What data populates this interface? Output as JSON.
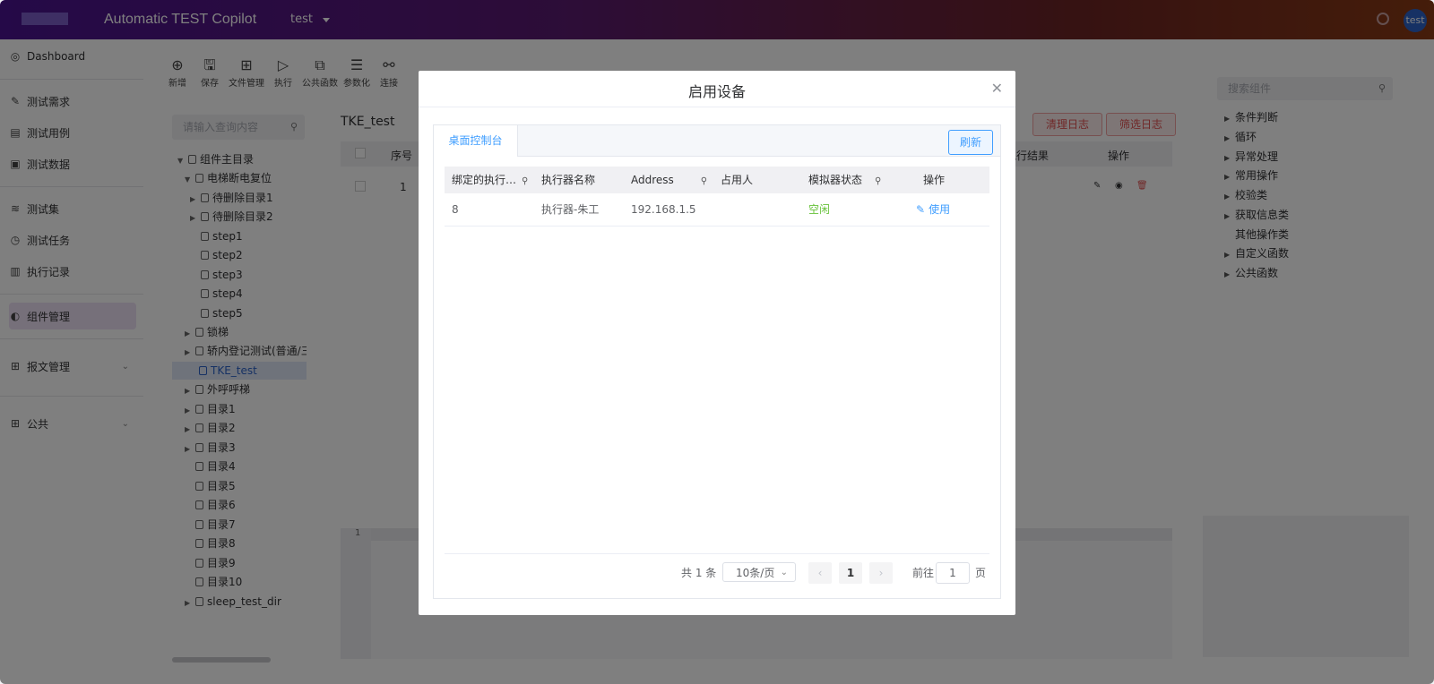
{
  "header": {
    "title": "Automatic TEST Copilot",
    "project": "test",
    "user": "test"
  },
  "sidebar": {
    "items": [
      {
        "label": "Dashboard",
        "icon": "dashboard-icon"
      },
      {
        "label": "测试需求",
        "icon": "requirement-icon"
      },
      {
        "label": "测试用例",
        "icon": "testcase-icon"
      },
      {
        "label": "测试数据",
        "icon": "testdata-icon"
      },
      {
        "label": "测试集",
        "icon": "layers-icon"
      },
      {
        "label": "测试任务",
        "icon": "timer-icon"
      },
      {
        "label": "执行记录",
        "icon": "record-icon"
      },
      {
        "label": "组件管理",
        "icon": "component-icon"
      },
      {
        "label": "报文管理",
        "icon": "grid-icon"
      },
      {
        "label": "公共",
        "icon": "grid-icon"
      }
    ]
  },
  "toolbar": {
    "items": [
      {
        "label": "新增",
        "glyph": "⊕"
      },
      {
        "label": "保存",
        "glyph": "🖫"
      },
      {
        "label": "文件管理",
        "glyph": "⊞"
      },
      {
        "label": "执行",
        "glyph": "▷"
      },
      {
        "label": "公共函数",
        "glyph": "⧉"
      },
      {
        "label": "参数化",
        "glyph": "☰"
      },
      {
        "label": "连接",
        "glyph": "⚯"
      }
    ]
  },
  "tree": {
    "search_placeholder": "请输入查询内容",
    "items": [
      {
        "label": "组件主目录"
      },
      {
        "label": "电梯断电复位"
      },
      {
        "label": "待删除目录1"
      },
      {
        "label": "待删除目录2"
      },
      {
        "label": "step1"
      },
      {
        "label": "step2"
      },
      {
        "label": "step3"
      },
      {
        "label": "step4"
      },
      {
        "label": "step5"
      },
      {
        "label": "锁梯"
      },
      {
        "label": "轿内登记测试(普通/三"
      },
      {
        "label": "TKE_test"
      },
      {
        "label": "外呼呼梯"
      },
      {
        "label": "目录1"
      },
      {
        "label": "目录2"
      },
      {
        "label": "目录3"
      },
      {
        "label": "目录4"
      },
      {
        "label": "目录5"
      },
      {
        "label": "目录6"
      },
      {
        "label": "目录7"
      },
      {
        "label": "目录8"
      },
      {
        "label": "目录9"
      },
      {
        "label": "目录10"
      },
      {
        "label": "sleep_test_dir"
      }
    ]
  },
  "main": {
    "title": "TKE_test",
    "columns": {
      "index": "序号",
      "result": "执行结果",
      "ops": "操作"
    },
    "row_index": "1",
    "buttons": {
      "clear_log": "清理日志",
      "filter_log": "筛选日志"
    },
    "editor_line": "1"
  },
  "right_panel": {
    "search_placeholder": "搜索组件",
    "items": [
      {
        "label": "条件判断",
        "arrow": true
      },
      {
        "label": "循环",
        "arrow": true
      },
      {
        "label": "异常处理",
        "arrow": true
      },
      {
        "label": "常用操作",
        "arrow": true
      },
      {
        "label": "校验类",
        "arrow": true
      },
      {
        "label": "获取信息类",
        "arrow": true
      },
      {
        "label": "其他操作类",
        "arrow": false
      },
      {
        "label": "自定义函数",
        "arrow": true
      },
      {
        "label": "公共函数",
        "arrow": true
      }
    ]
  },
  "modal": {
    "title": "启用设备",
    "tab": "桌面控制台",
    "refresh": "刷新",
    "columns": [
      "绑定的执行…",
      "执行器名称",
      "Address",
      "占用人",
      "模拟器状态",
      "操作"
    ],
    "rows": [
      {
        "id": "8",
        "name": "执行器-朱工",
        "address": "192.168.1.5",
        "occupant": "",
        "status": "空闲",
        "action": "使用"
      }
    ],
    "pager": {
      "total": "共 1 条",
      "page_size": "10条/页",
      "current": "1",
      "goto_label": "前往",
      "goto_value": "1",
      "page_suffix": "页"
    },
    "colors": {
      "primary": "#409eff",
      "status_idle": "#67c23a"
    }
  }
}
